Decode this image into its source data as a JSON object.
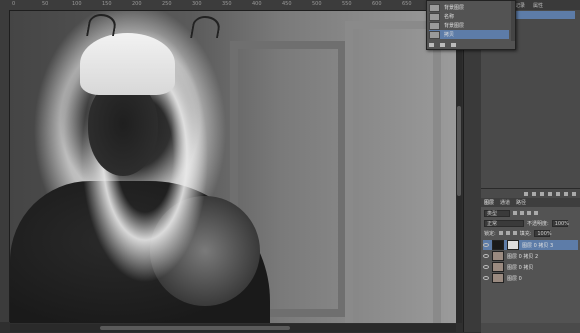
{
  "ruler": {
    "marks": [
      "0",
      "50",
      "100",
      "150",
      "200",
      "250",
      "300",
      "350",
      "400",
      "450",
      "500",
      "550",
      "600",
      "650"
    ]
  },
  "dropdown": {
    "items": [
      {
        "label": "背景图层",
        "selected": false
      },
      {
        "label": "名称",
        "selected": false
      },
      {
        "label": "背景图层",
        "selected": false
      },
      {
        "label": "拷贝",
        "selected": true
      }
    ]
  },
  "top_panel": {
    "tabs": [
      "历史记录",
      "属性"
    ]
  },
  "layers": {
    "tabs": [
      {
        "label": "图层"
      },
      {
        "label": "通道"
      },
      {
        "label": "路径"
      }
    ],
    "filter_label": "类型",
    "blend_mode": "正常",
    "opacity_label": "不透明度:",
    "opacity_value": "100%",
    "lock_label": "锁定:",
    "fill_label": "填充:",
    "fill_value": "100%",
    "items": [
      {
        "name": "图层 0 拷贝 3",
        "selected": true
      },
      {
        "name": "图层 0 拷贝 2",
        "selected": false
      },
      {
        "name": "图层 0 拷贝",
        "selected": false
      },
      {
        "name": "图层 0",
        "selected": false
      }
    ]
  },
  "colors": {
    "selection": "#5d7ca8",
    "panel": "#535353"
  }
}
